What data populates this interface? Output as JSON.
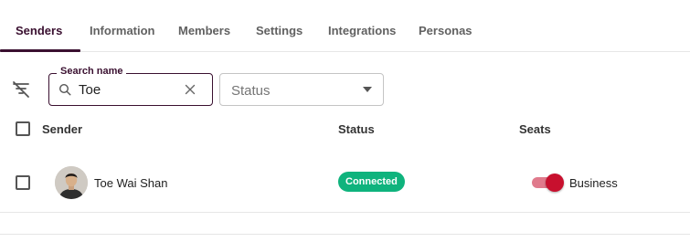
{
  "tabs": [
    {
      "label": "Senders",
      "active": true
    },
    {
      "label": "Information",
      "active": false
    },
    {
      "label": "Members",
      "active": false
    },
    {
      "label": "Settings",
      "active": false
    },
    {
      "label": "Integrations",
      "active": false
    },
    {
      "label": "Personas",
      "active": false
    }
  ],
  "filters": {
    "search": {
      "label": "Search name",
      "value": "Toe"
    },
    "status": {
      "placeholder": "Status"
    }
  },
  "table": {
    "columns": [
      "Sender",
      "Status",
      "Seats"
    ],
    "rows": [
      {
        "sender": "Toe Wai Shan",
        "status": "Connected",
        "seat_enabled": true,
        "seat": "Business"
      }
    ]
  },
  "colors": {
    "accent": "#3a1030",
    "status_connected": "#0fb37d",
    "toggle_on": "#c8102e"
  },
  "icons": [
    "filter-off-icon",
    "search-icon",
    "clear-icon",
    "chevron-down-icon",
    "avatar-photo"
  ]
}
